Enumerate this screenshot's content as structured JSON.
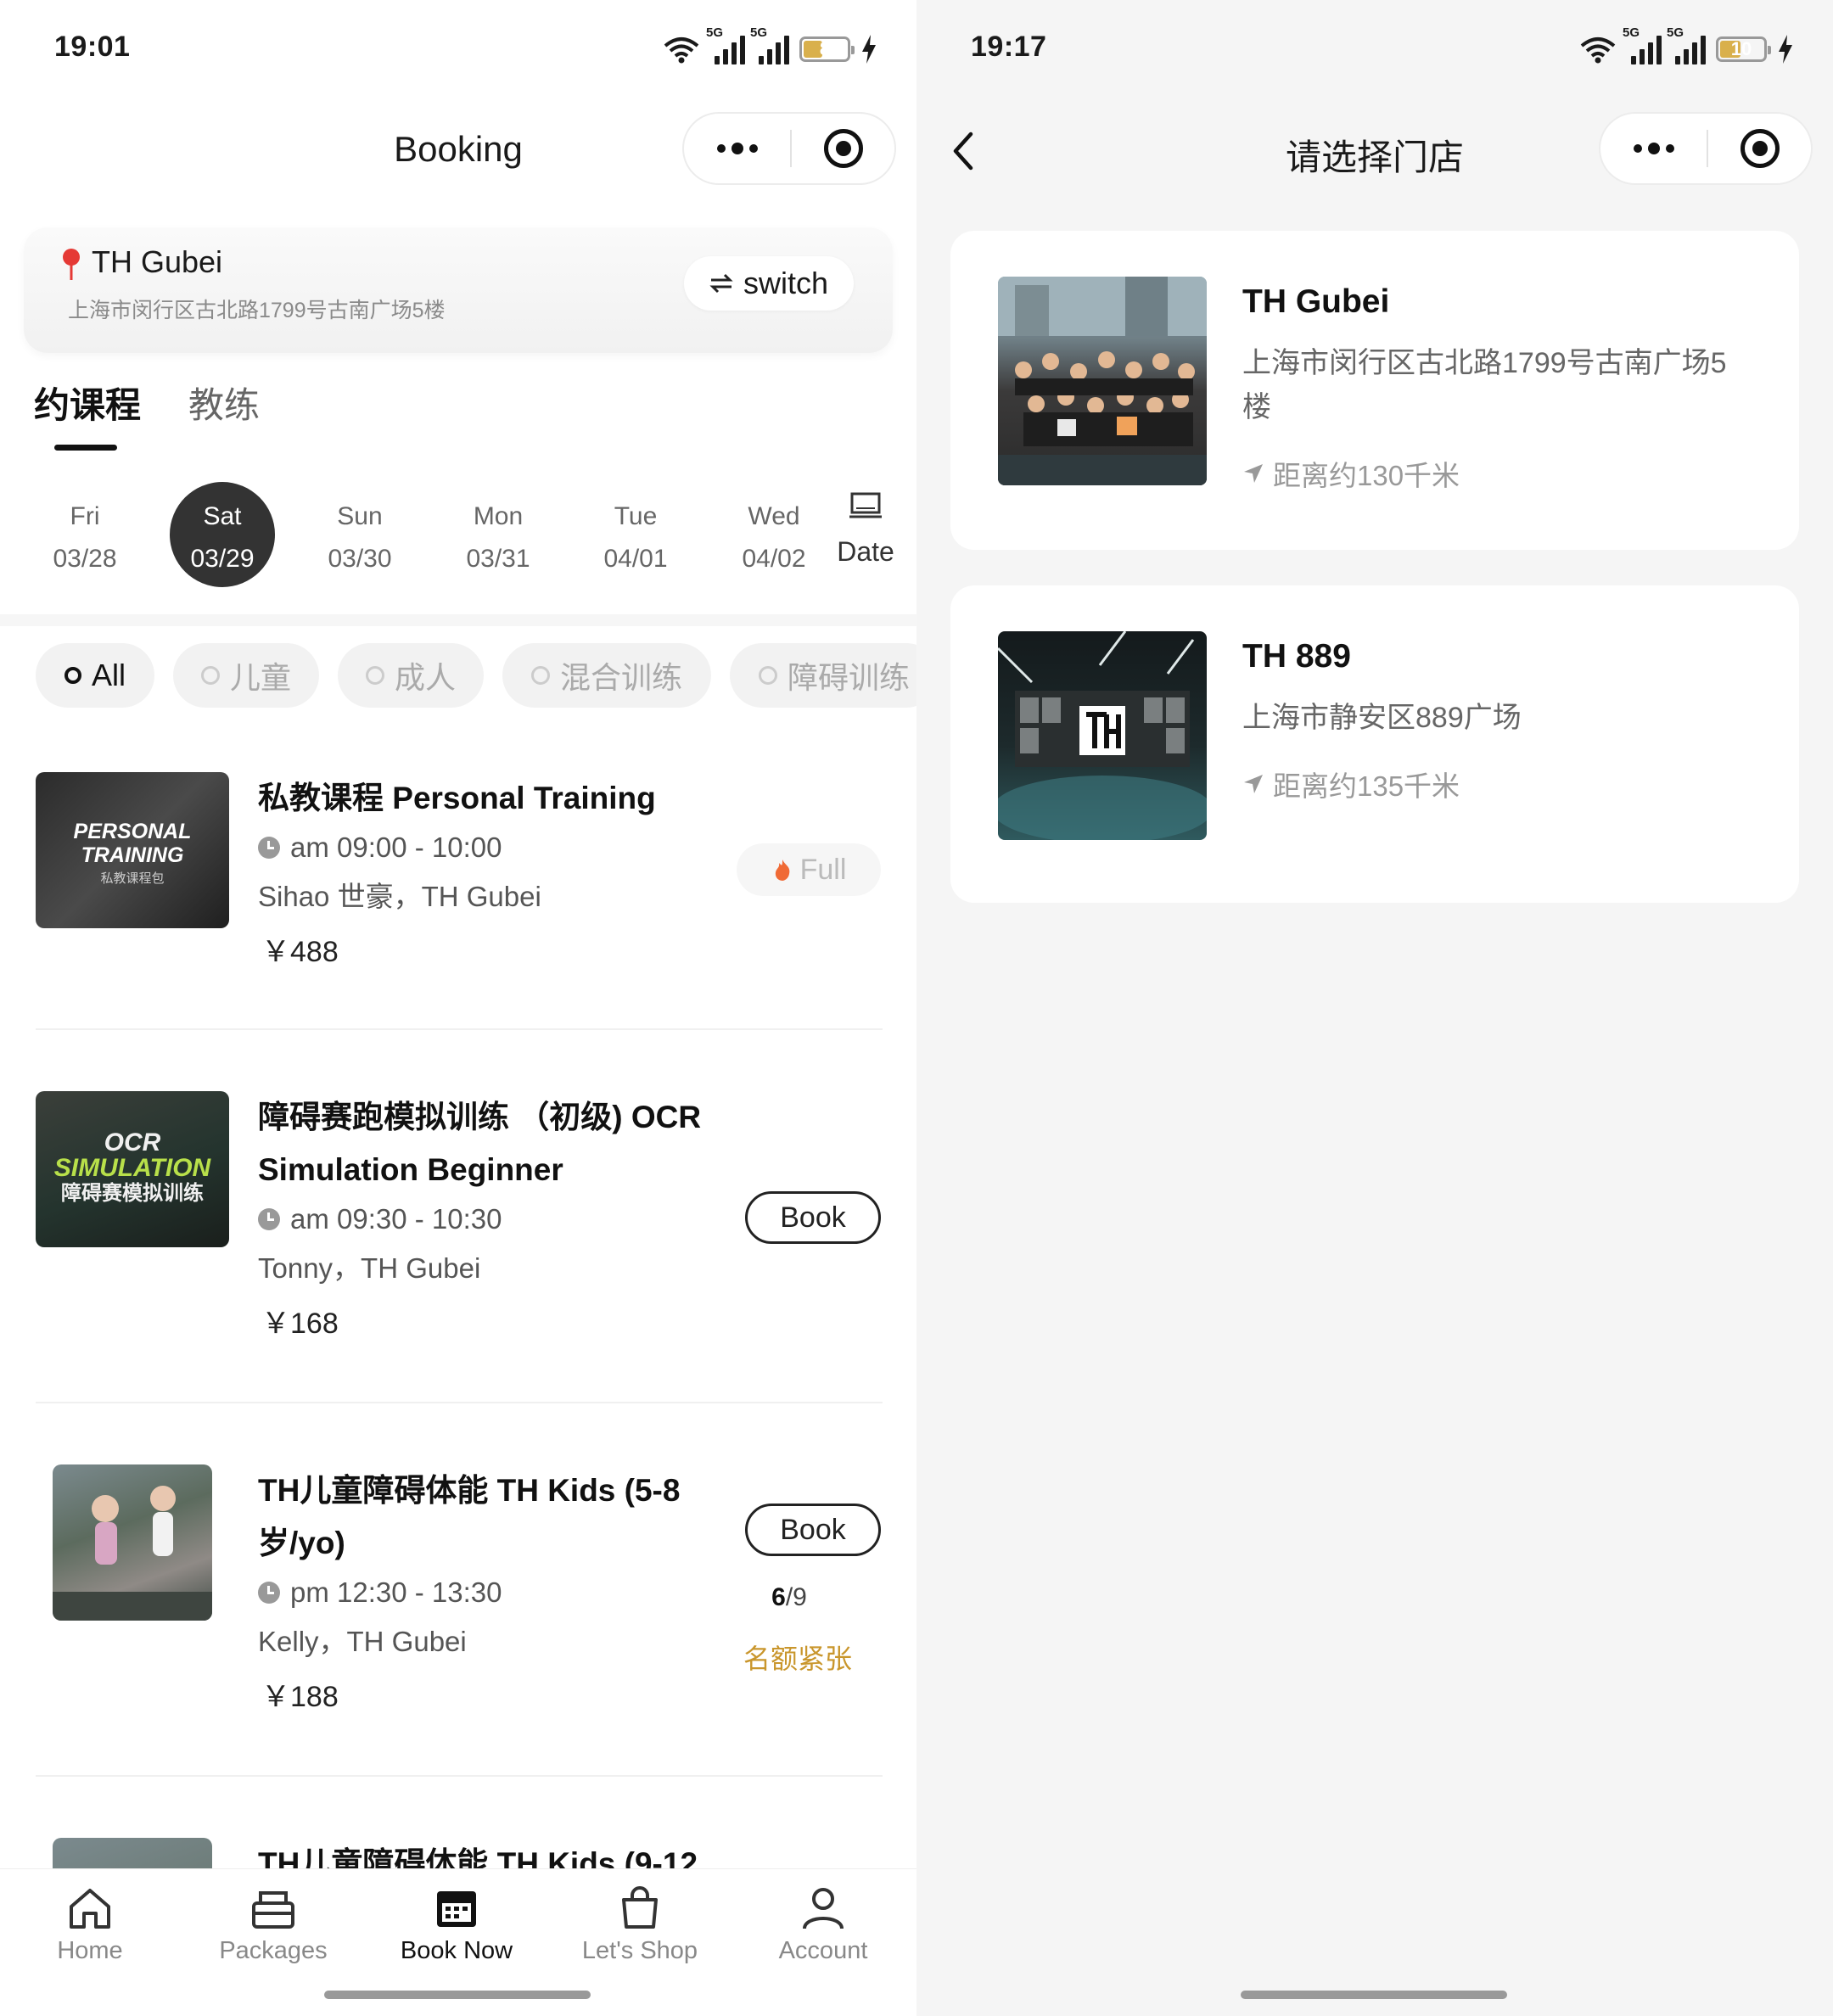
{
  "left": {
    "status": {
      "time": "19:01",
      "battery": "8",
      "net1": "5G",
      "net2": "5G"
    },
    "nav": {
      "title": "Booking"
    },
    "store": {
      "name": "TH Gubei",
      "address": "上海市闵行区古北路1799号古南广场5楼",
      "switch_label": "switch"
    },
    "tabs": [
      {
        "label": "约课程"
      },
      {
        "label": "教练"
      }
    ],
    "dates": [
      {
        "weekday": "Fri",
        "date": "03/28"
      },
      {
        "weekday": "Sat",
        "date": "03/29"
      },
      {
        "weekday": "Sun",
        "date": "03/30"
      },
      {
        "weekday": "Mon",
        "date": "03/31"
      },
      {
        "weekday": "Tue",
        "date": "04/01"
      },
      {
        "weekday": "Wed",
        "date": "04/02"
      }
    ],
    "date_picker_label": "Date",
    "filters": [
      {
        "label": "All"
      },
      {
        "label": "儿童"
      },
      {
        "label": "成人"
      },
      {
        "label": "混合训练"
      },
      {
        "label": "障碍训练"
      }
    ],
    "courses": [
      {
        "title": "私教课程 Personal Training",
        "time": "am 09:00 - 10:00",
        "coach": "Sihao 世豪，TH Gubei",
        "price": "￥488",
        "action": "Full",
        "thumb_text1": "PERSONAL",
        "thumb_text2": "TRAINING",
        "thumb_text3": "私教课程包"
      },
      {
        "title": "障碍赛跑模拟训练 （初级) OCR Simulation Beginner",
        "time": "am 09:30 - 10:30",
        "coach": "Tonny，TH Gubei",
        "price": "￥168",
        "action": "Book",
        "thumb_text1": "OCR",
        "thumb_text2": "SIMULATION",
        "thumb_text3": "障碍赛模拟训练"
      },
      {
        "title": "TH儿童障碍体能 TH Kids (5-8岁/yo)",
        "time": "pm 12:30 - 13:30",
        "coach": "Kelly，TH Gubei",
        "price": "￥188",
        "action": "Book",
        "slots_taken": "6",
        "slots_total": "/9",
        "slots_note": "名额紧张"
      },
      {
        "title": "TH儿童障碍体能 TH Kids (9-12"
      }
    ],
    "tabbar": [
      {
        "label": "Home"
      },
      {
        "label": "Packages"
      },
      {
        "label": "Book Now"
      },
      {
        "label": "Let's Shop"
      },
      {
        "label": "Account"
      }
    ]
  },
  "right": {
    "status": {
      "time": "19:17",
      "battery": "10",
      "net1": "5G",
      "net2": "5G"
    },
    "nav": {
      "title": "请选择门店"
    },
    "stores": [
      {
        "name": "TH Gubei",
        "address": "上海市闵行区古北路1799号古南广场5楼",
        "distance": "距离约130千米"
      },
      {
        "name": "TH 889",
        "address": "上海市静安区889广场",
        "distance": "距离约135千米"
      }
    ]
  },
  "colors": {
    "accent_dark": "#333333",
    "warning": "#c9962c",
    "battery": "#d9b04c",
    "pin": "#e53935"
  }
}
